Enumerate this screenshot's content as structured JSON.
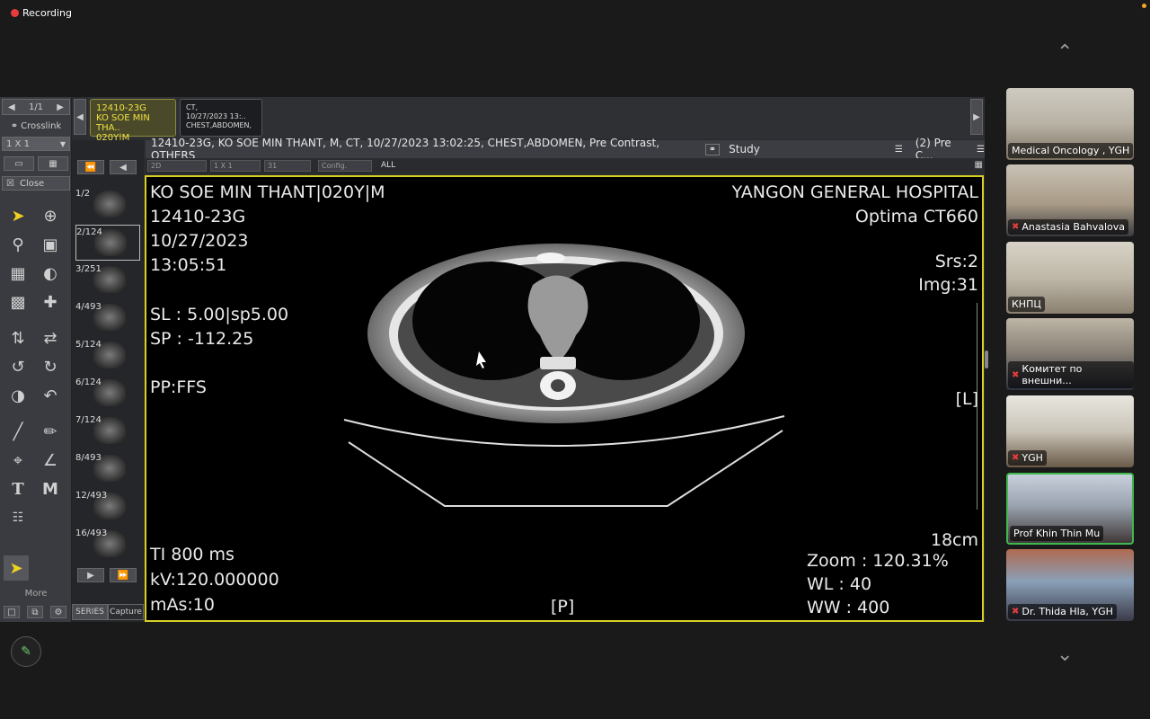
{
  "recording": {
    "label": "Recording"
  },
  "viewer": {
    "page_counter": "1/1",
    "crosslink": "Crosslink",
    "layout": "1 X 1",
    "close": "Close",
    "more": "More",
    "series_tab": "SERIES",
    "capture_tab": "Capture",
    "tabs": [
      {
        "line1": "12410-23G",
        "line2": "KO SOE MIN THA..",
        "line3": "020Y|M"
      },
      {
        "line1": "CT,",
        "line2": "10/27/2023 13:..",
        "line3": "CHEST,ABDOMEN,"
      }
    ],
    "info_bar": "12410-23G, KO SOE MIN THANT, M, CT, 10/27/2023 13:02:25, CHEST,ABDOMEN, Pre Contrast, OTHERS",
    "study_label": "Study",
    "pre_c_label": "(2) Pre C...",
    "controls": {
      "mode": "2D",
      "layout": "1 X 1",
      "num": "31",
      "config": "Config.",
      "all": "ALL"
    },
    "thumbnails": [
      {
        "label": "1/2"
      },
      {
        "label": "2/124"
      },
      {
        "label": "3/251"
      },
      {
        "label": "4/493"
      },
      {
        "label": "5/124"
      },
      {
        "label": "6/124"
      },
      {
        "label": "7/124"
      },
      {
        "label": "8/493"
      },
      {
        "label": "12/493"
      },
      {
        "label": "16/493"
      }
    ],
    "overlay": {
      "patient": "KO SOE MIN THANT|020Y|M",
      "patient_id": "12410-23G",
      "date": "10/27/2023",
      "time": "13:05:51",
      "sl": "SL : 5.00|sp5.00",
      "sp": "SP : -112.25",
      "pp": "PP:FFS",
      "hospital": "YANGON GENERAL HOSPITAL",
      "scanner": "Optima CT660",
      "srs": "Srs:2",
      "img": "Img:31",
      "left_marker": "[L]",
      "scale": "18cm",
      "ti": "TI 800 ms",
      "kv": "kV:120.000000",
      "mas": "mAs:10",
      "posterior": "[P]",
      "zoom": "Zoom : 120.31%",
      "wl": "WL : 40",
      "ww": "WW : 400"
    }
  },
  "participants": [
    {
      "name": "Medical Oncology , YGH",
      "muted": false,
      "icon": ""
    },
    {
      "name": "Anastasia Bahvalova",
      "muted": true,
      "icon": "mic-muted-icon"
    },
    {
      "name": "КНПЦ",
      "muted": false,
      "icon": ""
    },
    {
      "name": "Комитет по внешни...",
      "muted": true,
      "icon": "mic-muted-icon"
    },
    {
      "name": "YGH",
      "muted": true,
      "icon": "mic-muted-icon"
    },
    {
      "name": "Prof Khin Thin Mu",
      "muted": false,
      "icon": ""
    },
    {
      "name": "Dr. Thida Hla, YGH",
      "muted": true,
      "icon": "mic-muted-icon"
    }
  ],
  "colors": {
    "active_border": "#d6d024",
    "speaker_border": "#3fb950",
    "recording_dot": "#e83c3c"
  }
}
